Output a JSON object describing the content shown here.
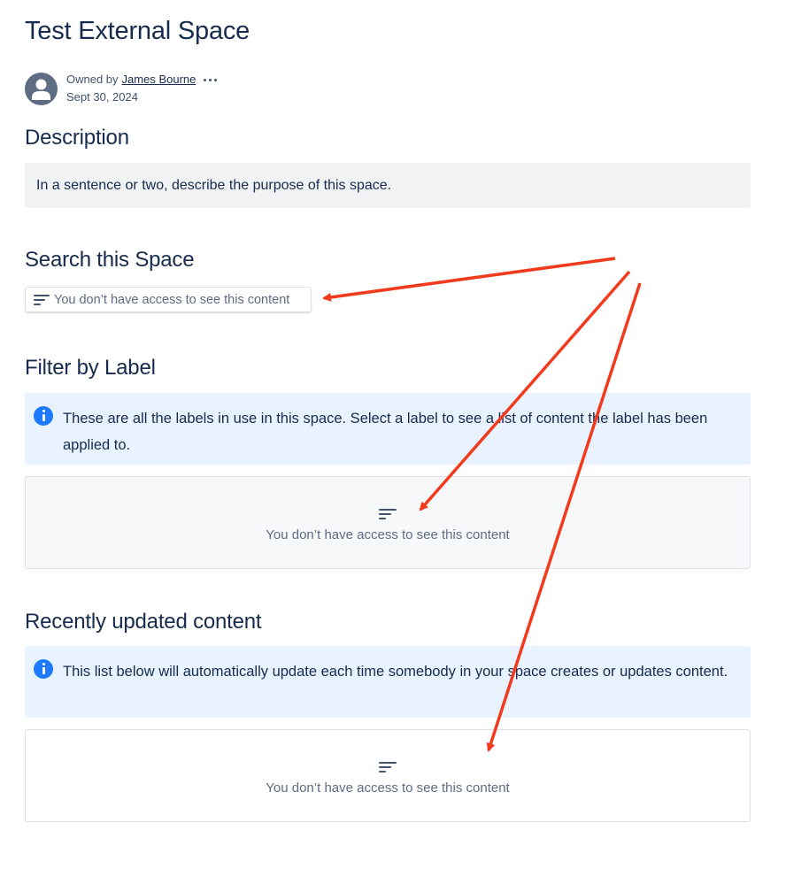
{
  "page": {
    "title": "Test External Space"
  },
  "byline": {
    "owned_by_label": "Owned by",
    "owner_name": "James Bourne",
    "date": "Sept 30, 2024",
    "avatar_icon": "default-user-avatar-icon",
    "more_icon": "more-horizontal-icon"
  },
  "description": {
    "heading": "Description",
    "text": "In a sentence or two, describe the purpose of this space."
  },
  "search": {
    "heading": "Search this Space",
    "restricted_text": "You don’t have access to see this content"
  },
  "filter_by_label": {
    "heading": "Filter by Label",
    "info_text": "These are all the labels in use in this space. Select a label to see a list of content the label has been applied to.",
    "restricted_text": "You don’t have access to see this content"
  },
  "recent": {
    "heading": "Recently updated content",
    "info_text": "This list below will automatically update each time somebody in your space creates or updates content.",
    "restricted_text": "You don’t have access to see this content"
  },
  "colors": {
    "text_primary": "#172b4d",
    "text_subtle": "#5e6c84",
    "info_background": "#e9f2ff",
    "info_icon": "#1d7afc",
    "annotation_arrow": "#f23a1d"
  }
}
